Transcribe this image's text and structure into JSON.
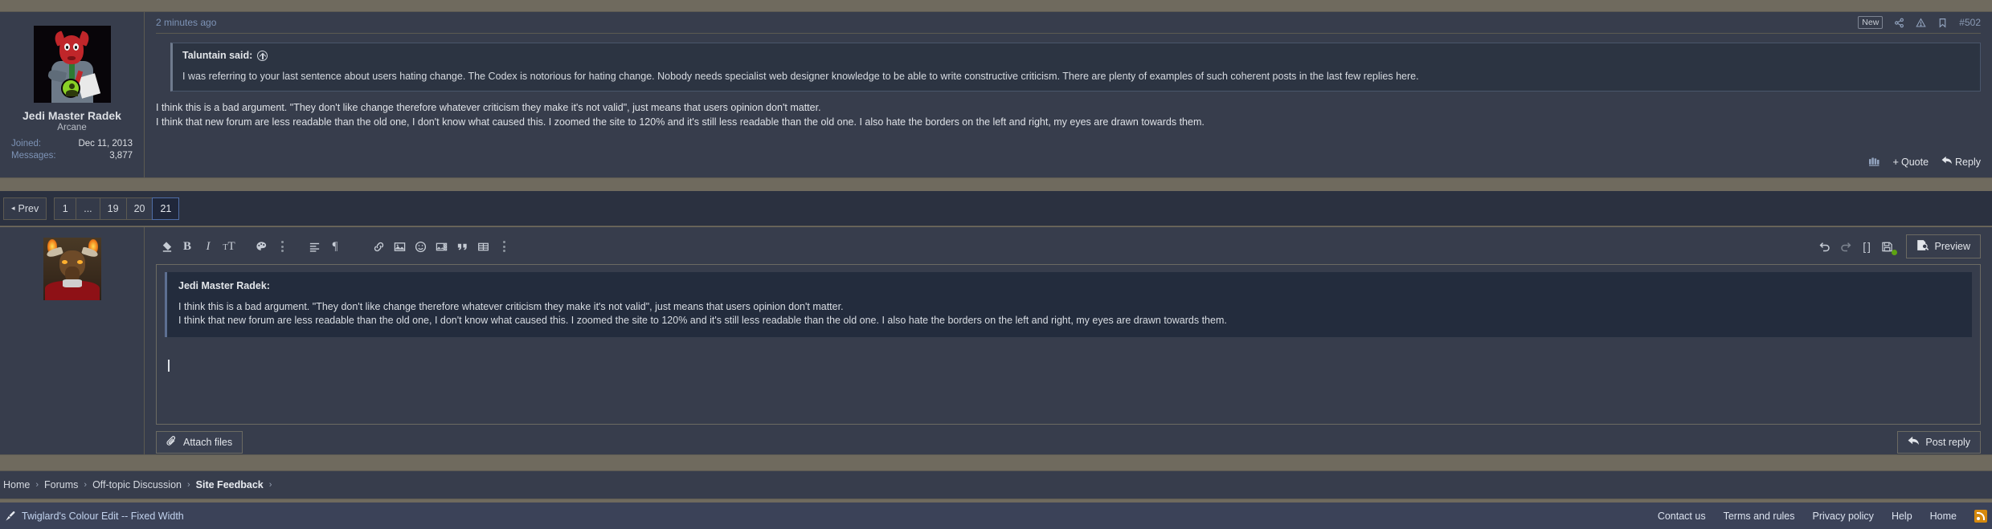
{
  "post": {
    "author": {
      "username": "Jedi Master Radek",
      "title": "Arcane",
      "stats": [
        {
          "label": "Joined:",
          "value": "Dec 11, 2013"
        },
        {
          "label": "Messages:",
          "value": "3,877"
        }
      ],
      "avatar_name": "devil-cartoon-avatar"
    },
    "timestamp": "2 minutes ago",
    "new_badge": "New",
    "post_number": "#502",
    "header_icons": [
      "share-icon",
      "report-icon",
      "bookmark-icon"
    ],
    "quote": {
      "title": "Taluntain said:",
      "jump_icon": "jump-to-post-icon",
      "text": "I was referring to your last sentence about users hating change. The Codex is notorious for hating change. Nobody needs specialist web designer knowledge to be able to write constructive criticism. There are plenty of examples of such coherent posts in the last few replies here."
    },
    "body_lines": [
      "I think this is a bad argument. \"They don't like change therefore whatever criticism they make it's not valid\", just means that users opinion don't matter.",
      "I think that new forum are less readable than the old one, I don't know what caused this. I zoomed the site to 120% and it's still less readable than the old one. I also hate the borders on the left and right, my eyes are drawn towards them."
    ],
    "actions": {
      "multiquote_icon": "multiquote-icon",
      "quote_label": "Quote",
      "reply_label": "Reply"
    }
  },
  "pagination": {
    "prev_label": "Prev",
    "pages": [
      "1",
      "...",
      "19",
      "20",
      "21"
    ],
    "current": "21"
  },
  "editor": {
    "avatar_name": "minotaur-avatar",
    "toolbar_left": [
      "remove-formatting-icon",
      "bold-icon",
      "italic-icon",
      "font-size-icon",
      "text-color-icon",
      "more-inline-icon",
      "align-icon",
      "paragraph-icon",
      "link-icon",
      "image-icon",
      "smilie-icon",
      "media-icon",
      "quote-icon",
      "table-icon",
      "more-block-icon"
    ],
    "toolbar_right": [
      "undo-icon",
      "redo-icon",
      "bbcode-icon",
      "draft-saved-icon"
    ],
    "preview_label": "Preview",
    "preview_icon": "preview-icon",
    "content": {
      "quote_name": "Jedi Master Radek:",
      "quote_lines": [
        "I think this is a bad argument. \"They don't like change therefore whatever criticism they make it's not valid\", just means that users opinion don't matter.",
        "I think that new forum are less readable than the old one, I don't know what caused this. I zoomed the site to 120% and it's still less readable than the old one. I also hate the borders on the left and right, my eyes are drawn towards them."
      ]
    },
    "attach_label": "Attach files",
    "attach_icon": "paperclip-icon",
    "post_reply_label": "Post reply",
    "post_reply_icon": "reply-arrow-icon"
  },
  "breadcrumb": {
    "items": [
      "Home",
      "Forums",
      "Off-topic Discussion",
      "Site Feedback"
    ],
    "separator": "›",
    "trailing_separator": "›"
  },
  "footer": {
    "style_label": "Twiglard's Colour Edit -- Fixed Width",
    "style_icon": "paintbrush-icon",
    "links": [
      "Contact us",
      "Terms and rules",
      "Privacy policy",
      "Help",
      "Home"
    ],
    "rss_icon": "rss-icon"
  },
  "colors": {
    "page_bg": "#6f6a5e",
    "panel_bg": "#373d4c",
    "quote_bg": "#2c3442",
    "accent_link": "#7d93b6",
    "footer_bg": "#3b4258",
    "rss_orange": "#d5890d"
  }
}
